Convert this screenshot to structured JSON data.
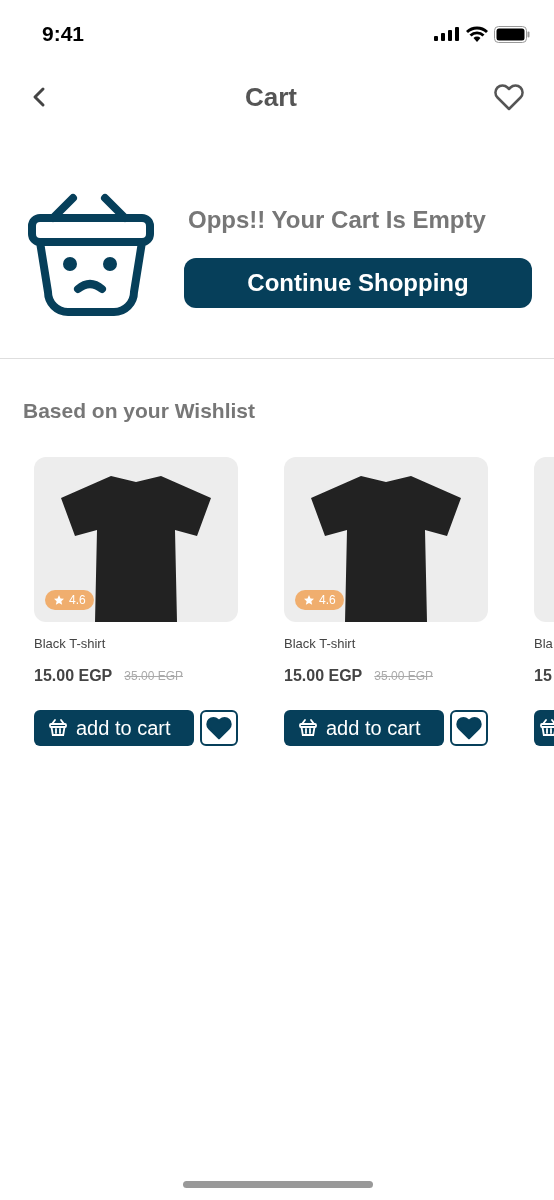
{
  "status_bar": {
    "time": "9:41"
  },
  "header": {
    "title": "Cart"
  },
  "empty_state": {
    "message": "Opps!! Your Cart Is Empty",
    "button": "Continue Shopping"
  },
  "section_title": "Based on your Wishlist",
  "products": [
    {
      "name": "Black T-shirt",
      "rating": "4.6",
      "price": "15.00 EGP",
      "old_price": "35.00 EGP",
      "button": "add to cart",
      "wishlisted": true
    },
    {
      "name": "Black T-shirt",
      "rating": "4.6",
      "price": "15.00 EGP",
      "old_price": "35.00 EGP",
      "button": "add to cart",
      "wishlisted": true
    },
    {
      "name": "Bla",
      "price": "15"
    }
  ]
}
